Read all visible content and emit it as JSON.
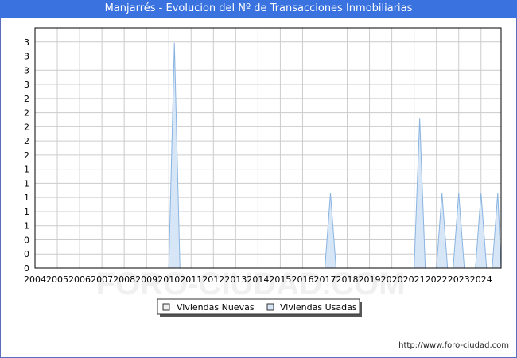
{
  "title": "Manjarrés - Evolucion del Nº de Transacciones Inmobiliarias",
  "watermark": "FORO-CIUDAD.COM",
  "source_url": "http://www.foro-ciudad.com",
  "colors": {
    "title_bg": "#3a73e0",
    "grid": "#cccccc",
    "series_fill": "#d6e6f7",
    "series_stroke": "#8ab4e0",
    "nuevas_box": "#eeeeee"
  },
  "chart_data": {
    "type": "area",
    "title": "Manjarrés - Evolucion del Nº de Transacciones Inmobiliarias",
    "xlabel": "",
    "ylabel": "",
    "x_ticks": [
      "2004",
      "2005",
      "2006",
      "2007",
      "2008",
      "2009",
      "2010",
      "2011",
      "2012",
      "2013",
      "2014",
      "2015",
      "2016",
      "2017",
      "2018",
      "2019",
      "2020",
      "2021",
      "2022",
      "2023",
      "2024"
    ],
    "y_ticks": [
      "0",
      "0",
      "0",
      "1",
      "1",
      "1",
      "1",
      "1",
      "2",
      "2",
      "2",
      "2",
      "2",
      "3",
      "3",
      "3",
      "3"
    ],
    "ylim": [
      0,
      3.2
    ],
    "xlim": [
      2004,
      2024.9
    ],
    "grid": true,
    "legend_position": "bottom",
    "series": [
      {
        "name": "Viviendas Nuevas",
        "points": []
      },
      {
        "name": "Viviendas Usadas",
        "points": [
          {
            "x": 2010.25,
            "y": 3
          },
          {
            "x": 2017.25,
            "y": 1
          },
          {
            "x": 2021.25,
            "y": 2
          },
          {
            "x": 2022.25,
            "y": 1
          },
          {
            "x": 2023.0,
            "y": 1
          },
          {
            "x": 2024.0,
            "y": 1
          },
          {
            "x": 2024.75,
            "y": 1
          }
        ]
      }
    ]
  }
}
